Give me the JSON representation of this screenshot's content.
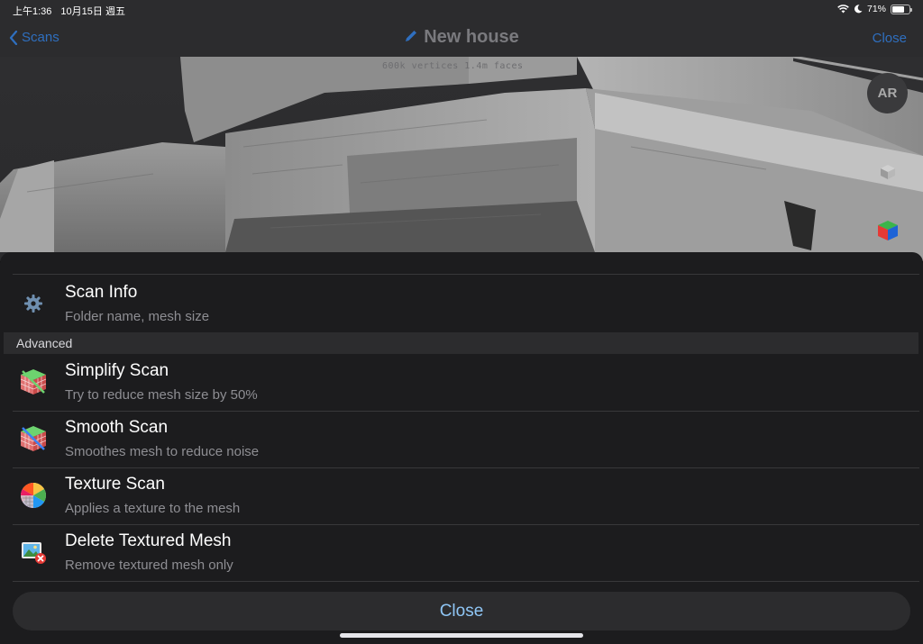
{
  "status": {
    "time": "上午1:36",
    "date": "10月15日 週五",
    "battery_text": "71%",
    "battery_level": 0.71
  },
  "nav": {
    "back_label": "Scans",
    "title": "New house",
    "close_label": "Close"
  },
  "viewer": {
    "overlay_text": "600k vertices   1.4m faces",
    "ar_label": "AR"
  },
  "menu": {
    "scan_info": {
      "title": "Scan Info",
      "subtitle": "Folder name, mesh size",
      "icon": "gear-icon"
    },
    "section_label": "Advanced",
    "items": [
      {
        "title": "Simplify Scan",
        "subtitle": "Try to reduce mesh size by 50%",
        "icon": "simplify-mesh-icon"
      },
      {
        "title": "Smooth Scan",
        "subtitle": "Smoothes mesh to reduce noise",
        "icon": "smooth-mesh-icon"
      },
      {
        "title": "Texture Scan",
        "subtitle": "Applies a texture to the mesh",
        "icon": "texture-color-wheel-icon"
      },
      {
        "title": "Delete Textured Mesh",
        "subtitle": "Remove textured mesh only",
        "icon": "delete-texture-icon"
      }
    ]
  },
  "close_button_label": "Close"
}
